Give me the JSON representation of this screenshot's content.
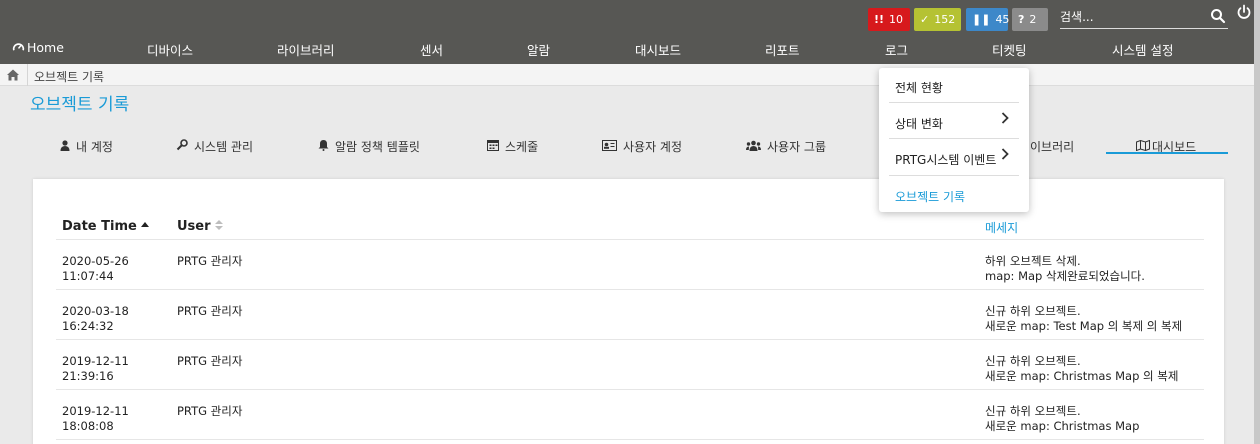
{
  "status": {
    "red": {
      "glyph": "!!",
      "count": "10",
      "color": "#d7191c"
    },
    "green": {
      "glyph": "✓",
      "count": "152",
      "color": "#b5c233"
    },
    "blue": {
      "glyph": "❚❚",
      "count": "45",
      "color": "#3d88c9"
    },
    "grey": {
      "glyph": "?",
      "count": "2",
      "color": "#8b8b8b"
    }
  },
  "search": {
    "placeholder": "검색..."
  },
  "nav": {
    "home": "Home",
    "devices": "디바이스",
    "library": "라이브러리",
    "sensors": "센서",
    "alarms": "알람",
    "dashboard": "대시보드",
    "reports": "리포트",
    "logs": "로그",
    "ticketing": "티켓팅",
    "system_settings": "시스템 설정"
  },
  "breadcrumb": {
    "current": "오브젝트 기록"
  },
  "page": {
    "title": "오브젝트 기록"
  },
  "tabs": [
    {
      "label": "내 계정",
      "icon": "user-icon"
    },
    {
      "label": "시스템 관리",
      "icon": "wrench-icon"
    },
    {
      "label": "알람 정책 템플릿",
      "icon": "bell-icon"
    },
    {
      "label": "스케줄",
      "icon": "calendar-icon"
    },
    {
      "label": "사용자 계정",
      "icon": "id-card-icon"
    },
    {
      "label": "사용자 그룹",
      "icon": "users-icon"
    },
    {
      "label": "이브러리",
      "icon": ""
    },
    {
      "label": "대시보드",
      "icon": "map-icon"
    }
  ],
  "table": {
    "headers": {
      "date_time": "Date Time",
      "user": "User",
      "message": "메세지"
    },
    "rows": [
      {
        "date": "2020-05-26",
        "time": "11:07:44",
        "user": "PRTG 관리자",
        "msg1": "하위 오브젝트 삭제.",
        "msg2": "map: Map 삭제완료되었습니다."
      },
      {
        "date": "2020-03-18",
        "time": "16:24:32",
        "user": "PRTG 관리자",
        "msg1": "신규 하위 오브젝트.",
        "msg2": "새로운 map: Test Map 의 복제 의 복제"
      },
      {
        "date": "2019-12-11",
        "time": "21:39:16",
        "user": "PRTG 관리자",
        "msg1": "신규 하위 오브젝트.",
        "msg2": "새로운 map: Christmas Map 의 복제"
      },
      {
        "date": "2019-12-11",
        "time": "18:08:08",
        "user": "PRTG 관리자",
        "msg1": "신규 하위 오브젝트.",
        "msg2": "새로운 map: Christmas Map"
      }
    ]
  },
  "dropdown": {
    "items": [
      "전체 현황",
      "상태 변화",
      "PRTG시스템 이벤트",
      "오브젝트 기록"
    ],
    "active": "오브젝트 기록"
  },
  "colors": {
    "topbar": "#575754",
    "accent": "#1a9bd7"
  }
}
